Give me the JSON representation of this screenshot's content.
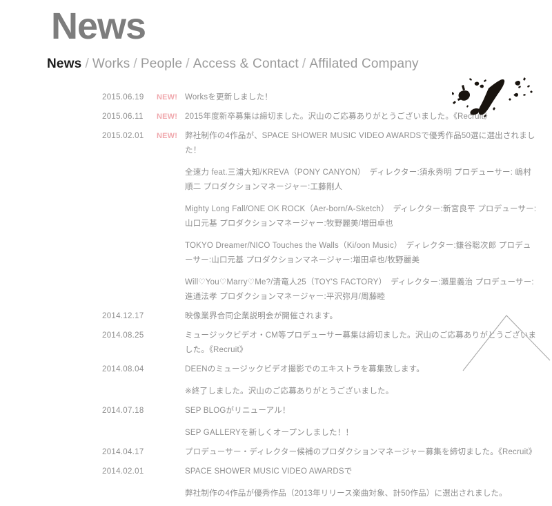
{
  "page": {
    "title": "News"
  },
  "nav": {
    "separator": "/",
    "items": [
      {
        "label": "News",
        "active": true
      },
      {
        "label": "Works",
        "active": false
      },
      {
        "label": "People",
        "active": false
      },
      {
        "label": "Access & Contact",
        "active": false
      },
      {
        "label": "Affilated Company",
        "active": false
      }
    ]
  },
  "colors": {
    "title": "#7d7d7d",
    "nav_active": "#1a1a1a",
    "nav_inactive": "#9a9a9a",
    "body_text": "#8e8e8e",
    "new_badge": "#f0a8ad",
    "deco_line": "#a9a9a9",
    "background": "#ffffff"
  },
  "news": {
    "new_badge_label": "NEW!",
    "items": [
      {
        "date": "2015.06.19",
        "is_new": true,
        "lines": [
          "Worksを更新しました！"
        ],
        "details": []
      },
      {
        "date": "2015.06.11",
        "is_new": true,
        "lines": [
          "2015年度新卒募集は締切ました。沢山のご応募ありがとうございました。《Recruit》"
        ],
        "details": []
      },
      {
        "date": "2015.02.01",
        "is_new": true,
        "lines": [
          "弊社制作の4作品が、SPACE SHOWER MUSIC VIDEO AWARDSで優秀作品50選に選出されました！"
        ],
        "details": [
          "全速力 feat.三浦大知/KREVA（PONY CANYON）　ディレクター:須永秀明 プロデューサー: 嶋村順二 プロダクションマネージャー:工藤剛人",
          "Mighty Long Fall/ONE OK ROCK（Aer-born/A-Sketch）　ディレクター:新宮良平 プロデューサー:山口元基 プロダクションマネージャー:牧野麗美/増田卓也",
          "TOKYO Dreamer/NICO Touches the Walls（Ki/oon Music）　ディレクター:鎌谷聡次郎 プロデューサー:山口元基 プロダクションマネージャー:増田卓也/牧野麗美",
          "Will♡You♡Marry♡Me?/清竜人25（TOY'S FACTORY）　ディレクター:瀬里義治 プロデューサー:進通法孝 プロダクションマネージャー:平沢弥月/周藤睦"
        ]
      },
      {
        "date": "2014.12.17",
        "is_new": false,
        "lines": [
          "映像業界合同企業説明会が開催されます。"
        ],
        "details": []
      },
      {
        "date": "2014.08.25",
        "is_new": false,
        "lines": [
          "ミュージックビデオ・CM等プロデューサー募集は締切ました。沢山のご応募ありがとうございました。《Recruit》"
        ],
        "details": []
      },
      {
        "date": "2014.08.04",
        "is_new": false,
        "lines": [
          "DEENのミュージックビデオ撮影でのエキストラを募集致します。",
          "※終了しました。沢山のご応募ありがとうございました。"
        ],
        "details": []
      },
      {
        "date": "2014.07.18",
        "is_new": false,
        "lines": [
          "SEP BLOGがリニューアル！",
          "SEP GALLERYを新しくオープンしました！！"
        ],
        "details": []
      },
      {
        "date": "2014.04.17",
        "is_new": false,
        "lines": [
          "プロデューサー・ディレクター候補のプロダクションマネージャー募集を締切ました。《Recruit》"
        ],
        "details": []
      },
      {
        "date": "2014.02.01",
        "is_new": false,
        "lines": [
          "SPACE SHOWER MUSIC VIDEO AWARDSで",
          "弊社制作の4作品が優秀作品（2013年リリース楽曲対象、計50作品）に選出されました。"
        ],
        "details": []
      }
    ]
  },
  "decorations": {
    "ink_splatter": "ink-splatter-graphic",
    "chevron": "chevron-graphic"
  }
}
